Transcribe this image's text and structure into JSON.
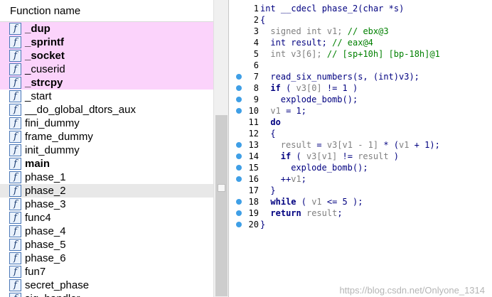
{
  "function_list": {
    "header": "Function name",
    "items": [
      {
        "name": "_dup",
        "bold": true,
        "lib": true
      },
      {
        "name": "_sprintf",
        "bold": true,
        "lib": true
      },
      {
        "name": "_socket",
        "bold": true,
        "lib": true
      },
      {
        "name": "_cuserid",
        "bold": false,
        "lib": true
      },
      {
        "name": "_strcpy",
        "bold": true,
        "lib": true
      },
      {
        "name": "_start",
        "bold": false,
        "lib": false
      },
      {
        "name": "__do_global_dtors_aux",
        "bold": false,
        "lib": false
      },
      {
        "name": "fini_dummy",
        "bold": false,
        "lib": false
      },
      {
        "name": "frame_dummy",
        "bold": false,
        "lib": false
      },
      {
        "name": "init_dummy",
        "bold": false,
        "lib": false
      },
      {
        "name": "main",
        "bold": true,
        "lib": false
      },
      {
        "name": "phase_1",
        "bold": false,
        "lib": false
      },
      {
        "name": "phase_2",
        "bold": false,
        "lib": false,
        "selected": true
      },
      {
        "name": "phase_3",
        "bold": false,
        "lib": false
      },
      {
        "name": "func4",
        "bold": false,
        "lib": false
      },
      {
        "name": "phase_4",
        "bold": false,
        "lib": false
      },
      {
        "name": "phase_5",
        "bold": false,
        "lib": false
      },
      {
        "name": "phase_6",
        "bold": false,
        "lib": false
      },
      {
        "name": "fun7",
        "bold": false,
        "lib": false
      },
      {
        "name": "secret_phase",
        "bold": false,
        "lib": false
      },
      {
        "name": "sig_handler",
        "bold": false,
        "lib": false
      }
    ]
  },
  "code": {
    "lines": [
      {
        "num": "1",
        "dot": false,
        "indent": 0,
        "tokens": [
          {
            "t": "int __cdecl phase_2(char *s)",
            "c": "blue"
          }
        ]
      },
      {
        "num": "2",
        "dot": false,
        "indent": 0,
        "tokens": [
          {
            "t": "{",
            "c": "blue"
          }
        ]
      },
      {
        "num": "3",
        "dot": false,
        "indent": 2,
        "tokens": [
          {
            "t": "signed int v1; ",
            "c": "gray"
          },
          {
            "t": "// ebx@3",
            "c": "green"
          }
        ]
      },
      {
        "num": "4",
        "dot": false,
        "indent": 2,
        "tokens": [
          {
            "t": "int result; ",
            "c": "blue"
          },
          {
            "t": "// eax@4",
            "c": "green"
          }
        ]
      },
      {
        "num": "5",
        "dot": false,
        "indent": 2,
        "tokens": [
          {
            "t": "int v3[6]; ",
            "c": "gray"
          },
          {
            "t": "// [sp+10h] [bp-18h]@1",
            "c": "green"
          }
        ]
      },
      {
        "num": "6",
        "dot": false,
        "indent": 0,
        "tokens": []
      },
      {
        "num": "7",
        "dot": true,
        "indent": 2,
        "tokens": [
          {
            "t": "read_six_numbers(s, (int)v3);",
            "c": "blue"
          }
        ]
      },
      {
        "num": "8",
        "dot": true,
        "indent": 2,
        "tokens": [
          {
            "t": "if",
            "c": "kw"
          },
          {
            "t": " ( ",
            "c": "blue"
          },
          {
            "t": "v3[0]",
            "c": "gray"
          },
          {
            "t": " != 1 )",
            "c": "blue"
          }
        ]
      },
      {
        "num": "9",
        "dot": true,
        "indent": 4,
        "tokens": [
          {
            "t": "explode_bomb();",
            "c": "blue"
          }
        ]
      },
      {
        "num": "10",
        "dot": true,
        "indent": 2,
        "tokens": [
          {
            "t": "v1",
            "c": "gray"
          },
          {
            "t": " = 1;",
            "c": "blue"
          }
        ]
      },
      {
        "num": "11",
        "dot": false,
        "indent": 2,
        "tokens": [
          {
            "t": "do",
            "c": "kw"
          }
        ]
      },
      {
        "num": "12",
        "dot": false,
        "indent": 2,
        "tokens": [
          {
            "t": "{",
            "c": "blue"
          }
        ]
      },
      {
        "num": "13",
        "dot": true,
        "indent": 4,
        "tokens": [
          {
            "t": "result",
            "c": "gray"
          },
          {
            "t": " = ",
            "c": "blue"
          },
          {
            "t": "v3[v1 - 1]",
            "c": "gray"
          },
          {
            "t": " * (",
            "c": "blue"
          },
          {
            "t": "v1",
            "c": "gray"
          },
          {
            "t": " + 1);",
            "c": "blue"
          }
        ]
      },
      {
        "num": "14",
        "dot": true,
        "indent": 4,
        "tokens": [
          {
            "t": "if",
            "c": "kw"
          },
          {
            "t": " ( ",
            "c": "blue"
          },
          {
            "t": "v3[v1]",
            "c": "gray"
          },
          {
            "t": " != ",
            "c": "blue"
          },
          {
            "t": "result",
            "c": "gray"
          },
          {
            "t": " )",
            "c": "blue"
          }
        ]
      },
      {
        "num": "15",
        "dot": true,
        "indent": 6,
        "tokens": [
          {
            "t": "explode_bomb();",
            "c": "blue"
          }
        ]
      },
      {
        "num": "16",
        "dot": true,
        "indent": 4,
        "tokens": [
          {
            "t": "++",
            "c": "blue"
          },
          {
            "t": "v1",
            "c": "gray"
          },
          {
            "t": ";",
            "c": "blue"
          }
        ]
      },
      {
        "num": "17",
        "dot": false,
        "indent": 2,
        "tokens": [
          {
            "t": "}",
            "c": "blue"
          }
        ]
      },
      {
        "num": "18",
        "dot": true,
        "indent": 2,
        "tokens": [
          {
            "t": "while",
            "c": "kw"
          },
          {
            "t": " ( ",
            "c": "blue"
          },
          {
            "t": "v1",
            "c": "gray"
          },
          {
            "t": " <= 5 );",
            "c": "blue"
          }
        ]
      },
      {
        "num": "19",
        "dot": true,
        "indent": 2,
        "tokens": [
          {
            "t": "return",
            "c": "kw"
          },
          {
            "t": " ",
            "c": "blue"
          },
          {
            "t": "result",
            "c": "gray"
          },
          {
            "t": ";",
            "c": "blue"
          }
        ]
      },
      {
        "num": "20",
        "dot": true,
        "indent": 0,
        "tokens": [
          {
            "t": "}",
            "c": "blue"
          }
        ]
      }
    ]
  },
  "watermark": "https://blog.csdn.net/Onlyone_1314",
  "colors": {
    "lib_highlight": "#fbd3fb",
    "selected_row": "#e8e8e8",
    "breakpoint_dot": "#3f9fe6",
    "code_text": "#000080",
    "comment": "#008000",
    "variable": "#808080"
  },
  "icons": {
    "function": "function-f-icon",
    "breakpoint": "breakpoint-dot-icon"
  }
}
